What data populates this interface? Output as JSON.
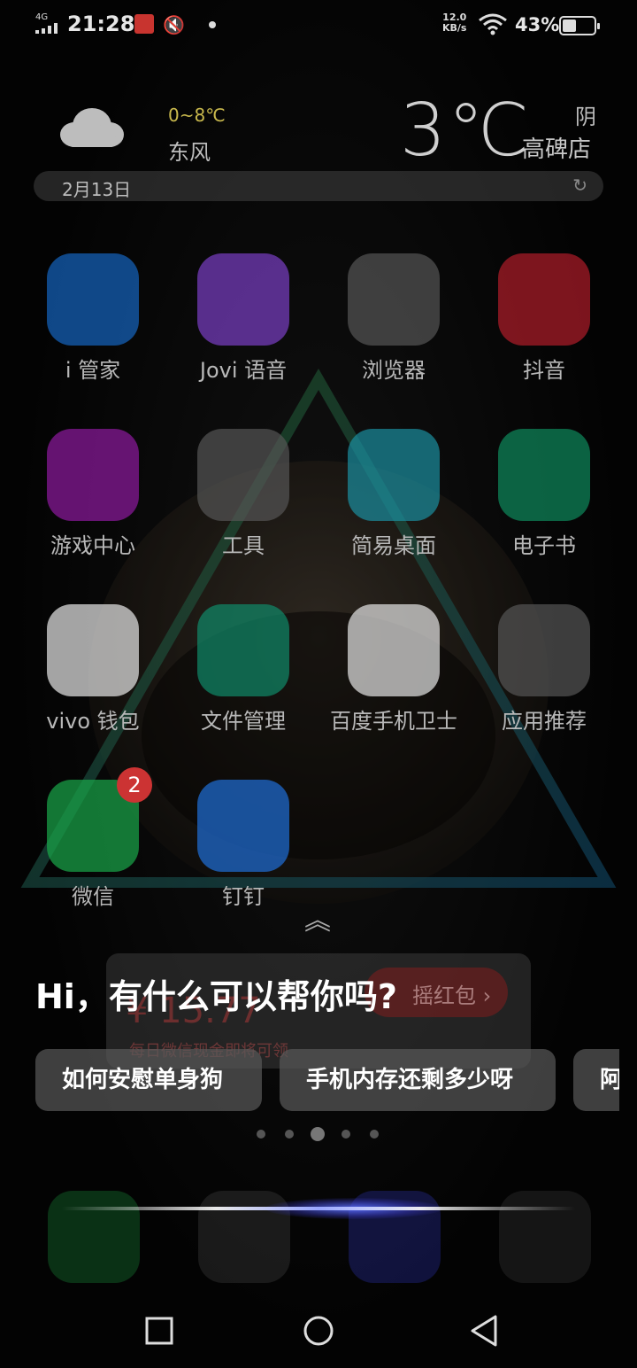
{
  "status_bar": {
    "network": "4G",
    "time": "21:28",
    "speed_value": "12.0",
    "speed_unit": "KB/s",
    "battery_percent": "43%",
    "battery_level": 0.43
  },
  "weather": {
    "temp_range": "0~8℃",
    "wind": "东风",
    "current_temp": "3℃",
    "condition": "阴",
    "city": "高碑店",
    "date": "2月13日",
    "icon": "cloud-icon"
  },
  "apps": [
    {
      "label": "i 管家",
      "icon": "shield-icon",
      "color": "#1565c0"
    },
    {
      "label": "Jovi 语音",
      "icon": "voice-wave-icon",
      "color": "#7b3fc4"
    },
    {
      "label": "浏览器",
      "icon": "folder-icon",
      "color": "#555"
    },
    {
      "label": "抖音",
      "icon": "douyin-icon",
      "color": "#b01c2a"
    },
    {
      "label": "游戏中心",
      "icon": "crown-icon",
      "color": "#8e1aa0"
    },
    {
      "label": "工具",
      "icon": "folder-icon",
      "color": "#555"
    },
    {
      "label": "简易桌面",
      "icon": "house-icon",
      "color": "#1b8ea0"
    },
    {
      "label": "电子书",
      "icon": "book-icon",
      "color": "#0e8a5c"
    },
    {
      "label": "vivo 钱包",
      "icon": "wallet-icon",
      "color": "#e8e8e8"
    },
    {
      "label": "文件管理",
      "icon": "file-folder-icon",
      "color": "#0f8a6a"
    },
    {
      "label": "百度手机卫士",
      "icon": "baidu-guard-icon",
      "color": "#e6e6e6"
    },
    {
      "label": "应用推荐",
      "icon": "folder-icon",
      "color": "#555"
    },
    {
      "label": "微信",
      "icon": "wechat-icon",
      "color": "#1aa84a",
      "badge": "2"
    },
    {
      "label": "钉钉",
      "icon": "dingtalk-icon",
      "color": "#1f6fd8"
    }
  ],
  "jovi": {
    "greeting": "Hi，有什么可以帮你吗?",
    "suggestions": [
      "如何安慰单身狗",
      "手机内存还剩多少呀",
      "阿"
    ],
    "page_count": 5,
    "active_page": 3
  },
  "background_card": {
    "button": "摇红包 ›",
    "amount": "¥ 15.77",
    "subtitle": "每日微信现金即将可领"
  },
  "dock": [
    {
      "icon": "phone-icon"
    },
    {
      "icon": "folder-icon"
    },
    {
      "icon": "camera-icon"
    },
    {
      "icon": "camera-lens-icon"
    }
  ],
  "nav": {
    "recent": "recent-apps-icon",
    "home": "home-icon",
    "back": "back-icon"
  }
}
